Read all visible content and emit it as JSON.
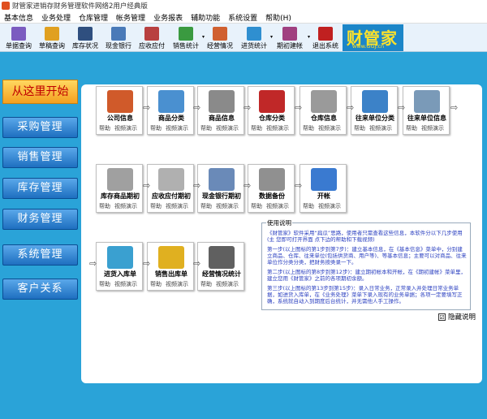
{
  "window": {
    "title": "财管家进销存财务管理软件网络2用户经典版"
  },
  "menu": [
    "基本信息",
    "业务处理",
    "仓库管理",
    "帐务管理",
    "业务报表",
    "辅助功能",
    "系统设置",
    "帮助(H)"
  ],
  "toolbar": [
    {
      "label": "单据查询",
      "icon": "search-doc-icon",
      "color": "#7b5cc0",
      "dd": false
    },
    {
      "label": "草稿查询",
      "icon": "draft-icon",
      "color": "#e0a020",
      "dd": false
    },
    {
      "label": "库存状况",
      "icon": "hourglass-icon",
      "color": "#2f4f7f",
      "dd": false
    },
    {
      "label": "现金银行",
      "icon": "bank-icon",
      "color": "#4a7ab8",
      "dd": false
    },
    {
      "label": "应收应付",
      "icon": "ledger-icon",
      "color": "#b84040",
      "dd": false
    },
    {
      "label": "销售统计",
      "icon": "bar-chart-icon",
      "color": "#3a9a40",
      "dd": true
    },
    {
      "label": "经营情况",
      "icon": "books-icon",
      "color": "#d06030",
      "dd": false
    },
    {
      "label": "进货统计",
      "icon": "cart-stats-icon",
      "color": "#2f8fd0",
      "dd": true
    },
    {
      "label": "期初建帐",
      "icon": "setup-icon",
      "color": "#a04080",
      "dd": true
    },
    {
      "label": "退出系统",
      "icon": "exit-icon",
      "color": "#c02020",
      "dd": false
    }
  ],
  "brand": {
    "title": "财管家",
    "sub": "www.GGJ.cn"
  },
  "sidebar": {
    "start": "从这里开始",
    "items": [
      "采购管理",
      "销售管理",
      "库存管理",
      "财务管理",
      "系统管理",
      "客户关系"
    ]
  },
  "cards": [
    {
      "label": "公司信息",
      "icon": "house-icon",
      "color": "#d05a2a"
    },
    {
      "label": "商品分类",
      "icon": "category-icon",
      "color": "#4a90d0"
    },
    {
      "label": "商品信息",
      "icon": "gear-icon",
      "color": "#8a8a8a"
    },
    {
      "label": "仓库分类",
      "icon": "warehouse-icon",
      "color": "#c02828"
    },
    {
      "label": "仓库信息",
      "icon": "folder-icon",
      "color": "#9a9a9a"
    },
    {
      "label": "往来单位分类",
      "icon": "contacts-icon",
      "color": "#3c82c8"
    },
    {
      "label": "往来单位信息",
      "icon": "phone-icon",
      "color": "#7a9ab8"
    },
    {
      "label": "库存商品期初",
      "icon": "pen-icon",
      "color": "#a0a0a0"
    },
    {
      "label": "应收应付期初",
      "icon": "document-icon",
      "color": "#b0b0b0"
    },
    {
      "label": "现金银行期初",
      "icon": "book-icon",
      "color": "#6a8ab8"
    },
    {
      "label": "数据备份",
      "icon": "usb-icon",
      "color": "#909090"
    },
    {
      "label": "开帐",
      "icon": "globe-icon",
      "color": "#3a7ad0"
    },
    {
      "label": "进货入库单",
      "icon": "inbox-icon",
      "color": "#3aa0d0"
    },
    {
      "label": "销售出库单",
      "icon": "outbox-icon",
      "color": "#e0b020"
    },
    {
      "label": "经营情况统计",
      "icon": "stats-cup-icon",
      "color": "#606060"
    }
  ],
  "card_links": {
    "help": "帮助",
    "video": "视频演示"
  },
  "notes": {
    "heading": "使用说明",
    "paragraphs": [
      "《财管家》软件采用“扁瓜”思路，使用者只需查看这些信息，本软件分以下几步使用(主 您即可打开界面 点下边的帮助和下载视频)",
      "第一步(以上图标的第1步到第7步)：建立基本信息，在《基本信息》菜单中，分别建立商品、仓库、往来单位(包括供货商、用户等)、等基本信息；主要可以对商品、往来单位作分类分类，把财务按类录一下。",
      "第二步(以上图标的第8步到第12步)：建立期初帐本和开帐，在《期初建帐》菜单里，建立您用《财管家》之前的各项期初余额。",
      "第三步(以上图标的第13步到第15步)：录入日常业务，正常录入并处理日常业务单据，如进货入库单，在《业务处理》菜单下录入现有的业务单据；各项一定要填写正确，系统就自动入到期度后台统计，并无需他人手工操作。"
    ],
    "hide_label": "隐藏说明",
    "hide_checked": "☑"
  }
}
